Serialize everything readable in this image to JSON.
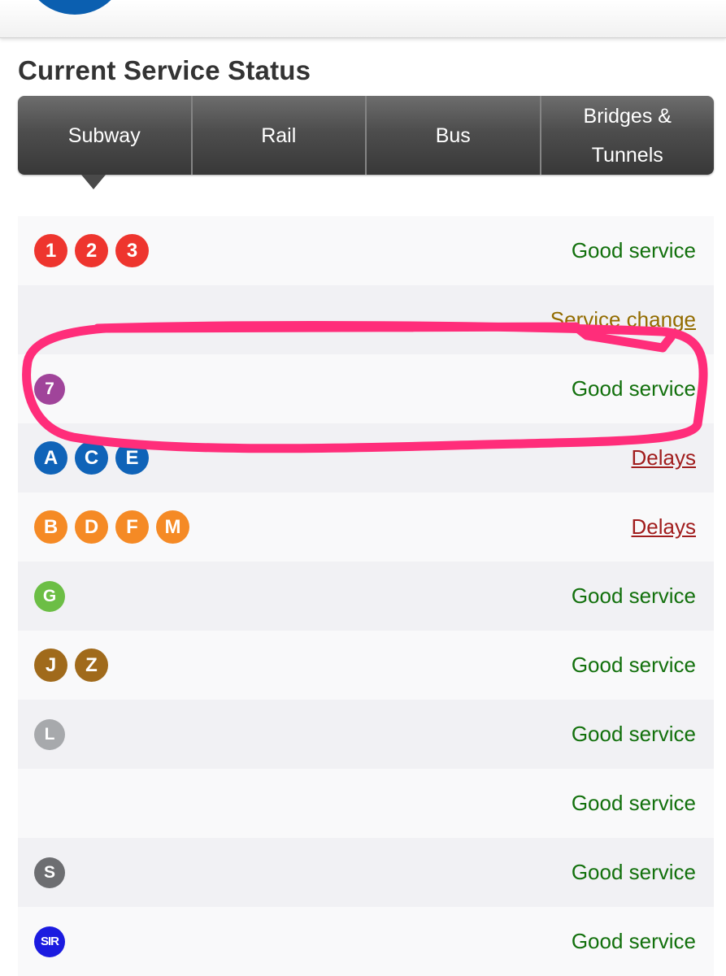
{
  "header": {
    "title": "Current Service Status"
  },
  "tabs": [
    {
      "label": "Subway",
      "selected": true
    },
    {
      "label": "Rail"
    },
    {
      "label": "Bus"
    },
    {
      "label": "Bridges & Tunnels"
    }
  ],
  "colors": {
    "tab_bar": "#4d4d4d",
    "good_service": "#12700c",
    "service_change": "#936c00",
    "delays": "#a11d1d",
    "annotation_stroke": "#ff2d7a"
  },
  "lines": [
    {
      "bullets": [
        {
          "label": "1",
          "color": "#ee352e"
        },
        {
          "label": "2",
          "color": "#ee352e"
        },
        {
          "label": "3",
          "color": "#ee352e"
        }
      ],
      "status": "Good service",
      "status_type": "good"
    },
    {
      "bullets": [],
      "status": "Service change",
      "status_type": "change"
    },
    {
      "bullets": [
        {
          "label": "7",
          "color": "#a0449a"
        }
      ],
      "status": "Good service",
      "status_type": "good",
      "annotation": "hand-drawn-pink-circle"
    },
    {
      "bullets": [
        {
          "label": "A",
          "color": "#0f63b8"
        },
        {
          "label": "C",
          "color": "#0f63b8"
        },
        {
          "label": "E",
          "color": "#0f63b8"
        }
      ],
      "status": "Delays",
      "status_type": "delay"
    },
    {
      "bullets": [
        {
          "label": "B",
          "color": "#f58a25"
        },
        {
          "label": "D",
          "color": "#f58a25"
        },
        {
          "label": "F",
          "color": "#f58a25"
        },
        {
          "label": "M",
          "color": "#f58a25"
        }
      ],
      "status": "Delays",
      "status_type": "delay"
    },
    {
      "bullets": [
        {
          "label": "G",
          "color": "#6cbe45"
        }
      ],
      "status": "Good service",
      "status_type": "good"
    },
    {
      "bullets": [
        {
          "label": "J",
          "color": "#a06a1b"
        },
        {
          "label": "Z",
          "color": "#a06a1b"
        }
      ],
      "status": "Good service",
      "status_type": "good"
    },
    {
      "bullets": [
        {
          "label": "L",
          "color": "#a7a9ac"
        }
      ],
      "status": "Good service",
      "status_type": "good"
    },
    {
      "bullets": [],
      "status": "Good service",
      "status_type": "good"
    },
    {
      "bullets": [
        {
          "label": "S",
          "color": "#6d6e71"
        }
      ],
      "status": "Good service",
      "status_type": "good"
    },
    {
      "bullets": [
        {
          "label": "SIR",
          "color": "#1b1be0"
        }
      ],
      "status": "Good service",
      "status_type": "good"
    }
  ]
}
